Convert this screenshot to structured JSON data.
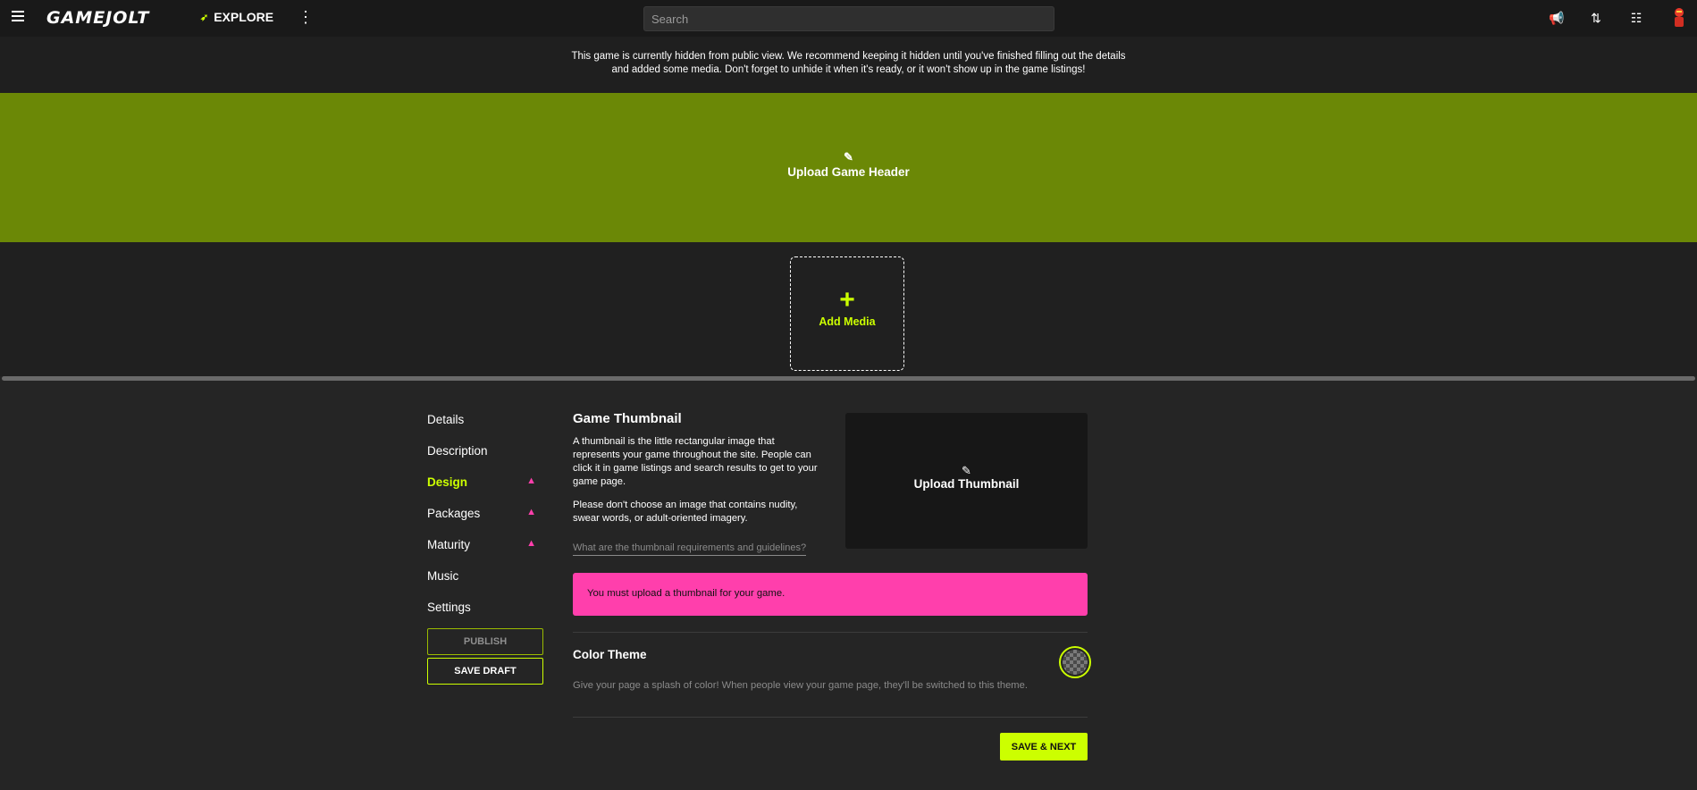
{
  "topbar": {
    "logo": "GAMEJOLT",
    "explore_label": "EXPLORE",
    "search_placeholder": "Search",
    "icons": [
      "menu-icon",
      "explore-icon",
      "more-vertical-icon",
      "megaphone-icon",
      "activity-icon",
      "quest-icon",
      "avatar-icon"
    ]
  },
  "notice": {
    "text": "This game is currently hidden from public view. We recommend keeping it hidden until you've finished filling out the details and added some media. Don't forget to unhide it when it's ready, or it won't show up in the game listings!"
  },
  "header": {
    "upload_label": "Upload Game Header",
    "background_color": "#6b8806"
  },
  "media": {
    "add_label": "Add Media"
  },
  "sidenav": {
    "items": [
      {
        "label": "Details",
        "warning": false,
        "active": false
      },
      {
        "label": "Description",
        "warning": false,
        "active": false
      },
      {
        "label": "Design",
        "warning": true,
        "active": true
      },
      {
        "label": "Packages",
        "warning": true,
        "active": false
      },
      {
        "label": "Maturity",
        "warning": true,
        "active": false
      },
      {
        "label": "Music",
        "warning": false,
        "active": false
      },
      {
        "label": "Settings",
        "warning": false,
        "active": false
      }
    ],
    "publish_label": "PUBLISH",
    "save_draft_label": "SAVE DRAFT"
  },
  "thumbnail": {
    "title": "Game Thumbnail",
    "para1": "A thumbnail is the little rectangular image that represents your game throughout the site. People can click it in game listings and search results to get to your game page.",
    "para2": "Please don't choose an image that contains nudity, swear words, or adult-oriented imagery.",
    "guidelines_link": "What are the thumbnail requirements and guidelines?",
    "upload_label": "Upload Thumbnail",
    "error": "You must upload a thumbnail for your game."
  },
  "color_theme": {
    "title": "Color Theme",
    "description": "Give your page a splash of color! When people view your game page, they'll be switched to this theme."
  },
  "footer": {
    "save_next_label": "SAVE & NEXT"
  },
  "colors": {
    "accent": "#ccff00",
    "error": "#ff3fac"
  }
}
